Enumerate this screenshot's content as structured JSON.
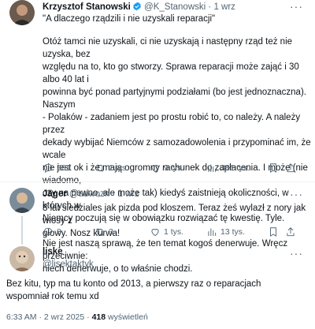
{
  "post1": {
    "author_name": "Krzysztof Stanowski",
    "author_handle": "@K_Stanowski",
    "time": "1 wrz",
    "headline": "\"A dlaczego rządzili i nie uzyskali reparacji\"",
    "paragraphs": [
      [
        "Otóż tamci nie uzyskali, ci nie uzyskają i następny rząd też nie uzyska, bez",
        "względu na to, kto go stworzy. Sprawa reparacji może zająć i 30 albo 40 lat i",
        "powinna być ponad partyjnymi podziałami (bo jest jednoznaczna). Naszym",
        "- Polaków - zadaniem jest po prostu robić to, co należy. A należy przez",
        "dekady wybijać Niemców z samozadowolenia i przypominać im, że wcale",
        "nie jest ok i że mają ogromny rachunek do zapłacenia. I może (nie wiadomo,",
        "czy na pewno, ale może tak) kiedyś zaistnieją okoliczności, w których w",
        "Niemcy poczują się w obowiązku rozwiązać tę kwestię. Tyle."
      ],
      [
        "Nie jest naszą sprawą, że ten temat kogoś denerwuje. Wręcz przeciwnie:",
        "niech denerwuje, o to właśnie chodzi."
      ]
    ],
    "stats": {
      "replies": "581",
      "reposts": "1 tys.",
      "likes": "9 tys.",
      "views": "381 tys."
    }
  },
  "post2": {
    "author_name": "Jäger",
    "author_handle": "@adwozn",
    "time": "1 wrz",
    "lines": [
      "8 lat siedziales jak pizda pod kloszem. Teraz żeś wylazł z nory jak włosy z",
      "głowy. Nosz kurwa!"
    ],
    "stats": {
      "replies": "8",
      "reposts": "3",
      "likes": "1 tys.",
      "views": "13 tys."
    }
  },
  "post3": {
    "author_name": "liske",
    "author_handle": "@lisektaktyk",
    "lines": [
      "Bez kitu, typ ma tu konto od 2013, a pierwszy raz o reparacjach",
      "wspomniał rok temu xd"
    ],
    "meta_time": "6:33 AM · 2 wrz 2025 · ",
    "meta_views_count": "418",
    "meta_views_label": " wyświetleń"
  },
  "colors": {
    "verified": "#1d9bf0",
    "muted": "#536471",
    "line": "#cfd9de"
  },
  "icons": [
    "more-icon",
    "verified-badge-icon",
    "reply-icon",
    "repost-icon",
    "like-icon",
    "views-icon",
    "bookmark-icon",
    "share-icon"
  ]
}
